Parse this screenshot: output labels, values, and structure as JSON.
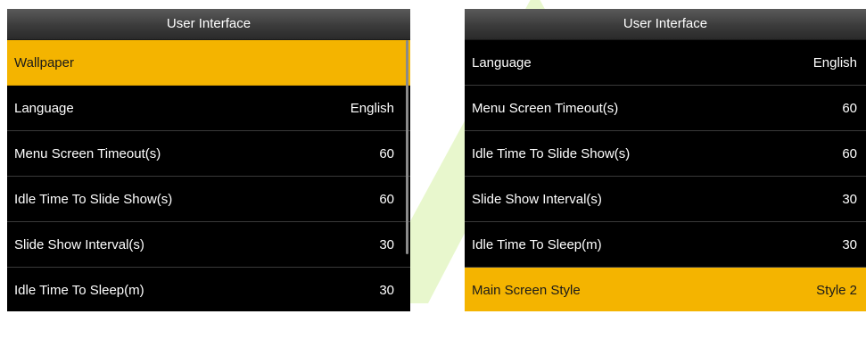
{
  "watermark_color": "#e6f6c8",
  "accent_color": "#f4b400",
  "left_screen": {
    "title": "User Interface",
    "items": [
      {
        "label": "Wallpaper",
        "value": "",
        "selected": true
      },
      {
        "label": "Language",
        "value": "English"
      },
      {
        "label": "Menu Screen Timeout(s)",
        "value": "60"
      },
      {
        "label": "Idle Time To Slide Show(s)",
        "value": "60"
      },
      {
        "label": "Slide Show Interval(s)",
        "value": "30"
      },
      {
        "label": "Idle Time To Sleep(m)",
        "value": "30"
      }
    ]
  },
  "right_screen": {
    "title": "User Interface",
    "items": [
      {
        "label": "Language",
        "value": "English"
      },
      {
        "label": "Menu Screen Timeout(s)",
        "value": "60"
      },
      {
        "label": "Idle Time To Slide Show(s)",
        "value": "60"
      },
      {
        "label": "Slide Show Interval(s)",
        "value": "30"
      },
      {
        "label": "Idle Time To Sleep(m)",
        "value": "30"
      },
      {
        "label": "Main Screen Style",
        "value": "Style 2",
        "selected": true
      }
    ]
  }
}
